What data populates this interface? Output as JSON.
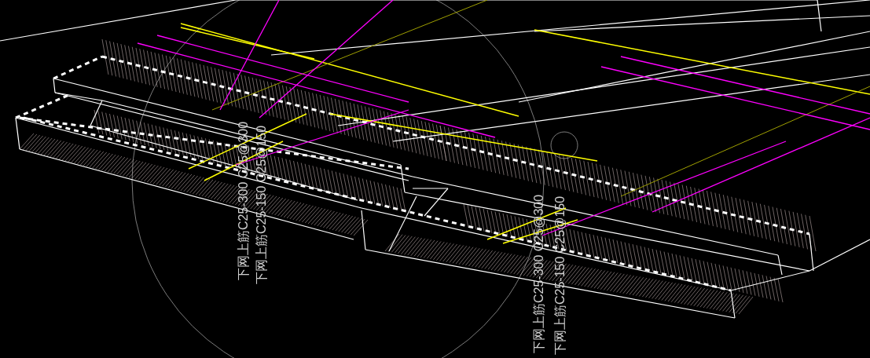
{
  "viewport": {
    "labels": [
      {
        "text": "下网上筋C25-300 C25@300"
      },
      {
        "text": "下网上筋C25-150 C25@150"
      },
      {
        "text": "下网上筋C25-300 C25@300"
      },
      {
        "text": "下网上筋C25-150 C25@150"
      }
    ]
  }
}
